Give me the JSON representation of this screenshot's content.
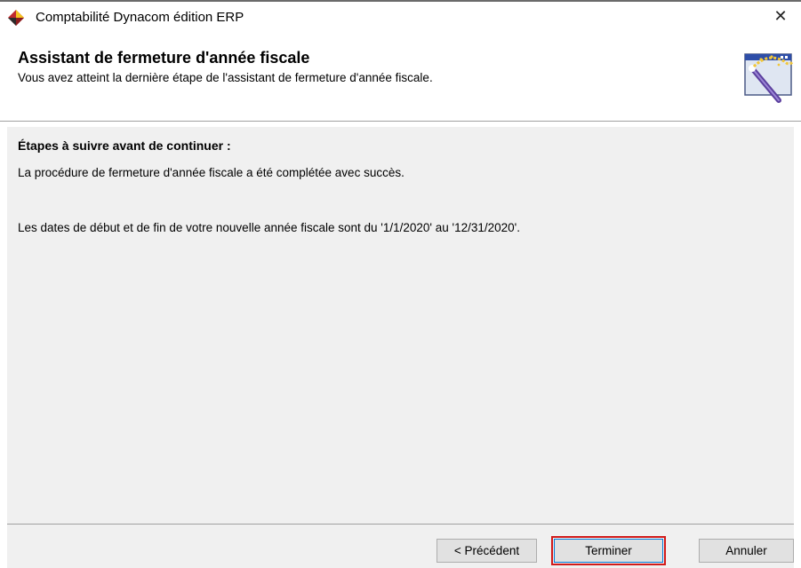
{
  "window": {
    "title": "Comptabilité Dynacom édition ERP",
    "app_icon": "dynacom-diamond-icon",
    "close_icon": "close-icon",
    "close_glyph": "✕"
  },
  "header": {
    "title": "Assistant de fermeture d'année fiscale",
    "subtitle": "Vous avez atteint la dernière étape de l'assistant de fermeture d'année fiscale.",
    "icon": "wizard-wand-icon"
  },
  "content": {
    "heading": "Étapes à suivre avant de continuer :",
    "line1": "La procédure de fermeture d'année fiscale a été complétée avec succès.",
    "line2": "Les dates de début et de fin de votre nouvelle année fiscale sont du '1/1/2020' au '12/31/2020'."
  },
  "buttons": {
    "previous": "< Précédent",
    "finish": "Terminer",
    "cancel": "Annuler"
  },
  "colors": {
    "highlight": "#d11a1a",
    "focus_border": "#0078d7",
    "panel_bg": "#f0f0f0"
  }
}
